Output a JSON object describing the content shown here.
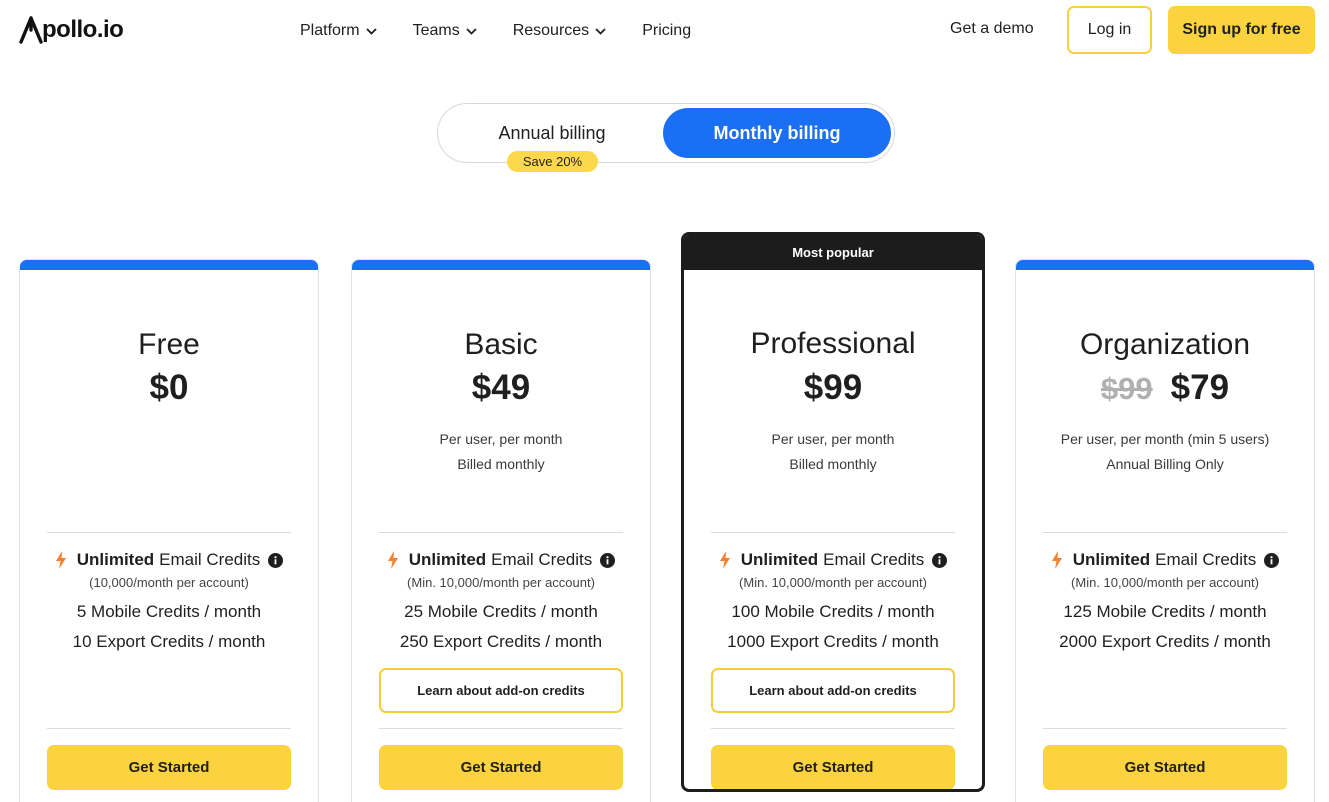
{
  "header": {
    "logo_text": "pollo.io",
    "nav": [
      {
        "label": "Platform"
      },
      {
        "label": "Teams"
      },
      {
        "label": "Resources"
      },
      {
        "label": "Pricing"
      }
    ],
    "get_demo": "Get a demo",
    "login": "Log in",
    "signup": "Sign up for free"
  },
  "billing": {
    "annual": "Annual billing",
    "monthly": "Monthly billing",
    "save_badge": "Save 20%",
    "selected": "Monthly billing"
  },
  "plans": [
    {
      "name": "Free",
      "price": "$0",
      "old_price": "",
      "sub1": "",
      "sub2": "",
      "email_bold": "Unlimited",
      "email_rest": "Email Credits",
      "email_note": "(10,000/month per account)",
      "mobile": "5 Mobile Credits / month",
      "export": "10 Export Credits / month",
      "addon": "",
      "cta": "Get Started"
    },
    {
      "name": "Basic",
      "price": "$49",
      "old_price": "",
      "sub1": "Per user, per month",
      "sub2": "Billed monthly",
      "email_bold": "Unlimited",
      "email_rest": "Email Credits",
      "email_note": "(Min. 10,000/month per account)",
      "mobile": "25 Mobile Credits / month",
      "export": "250 Export Credits / month",
      "addon": "Learn about add-on credits",
      "cta": "Get Started"
    },
    {
      "name": "Professional",
      "badge": "Most popular",
      "price": "$99",
      "old_price": "",
      "sub1": "Per user, per month",
      "sub2": "Billed monthly",
      "email_bold": "Unlimited",
      "email_rest": "Email Credits",
      "email_note": "(Min. 10,000/month per account)",
      "mobile": "100 Mobile Credits / month",
      "export": "1000 Export Credits / month",
      "addon": "Learn about add-on credits",
      "cta": "Get Started"
    },
    {
      "name": "Organization",
      "price": "$79",
      "old_price": "$99",
      "sub1": "Per user, per month (min 5 users)",
      "sub2": "Annual Billing Only",
      "email_bold": "Unlimited",
      "email_rest": "Email Credits",
      "email_note": "(Min. 10,000/month per account)",
      "mobile": "125 Mobile Credits / month",
      "export": "2000 Export Credits / month",
      "addon": "",
      "cta": "Get Started"
    }
  ],
  "colors": {
    "accent_blue": "#1a6ff5",
    "cta_yellow": "#fbd33f",
    "bolt_orange": "#f47f2c",
    "popular_dark": "#1c1c1c"
  },
  "icons": {
    "bolt": "lightning-bolt-icon",
    "info": "info-circle-icon",
    "chevron": "chevron-down-icon"
  }
}
